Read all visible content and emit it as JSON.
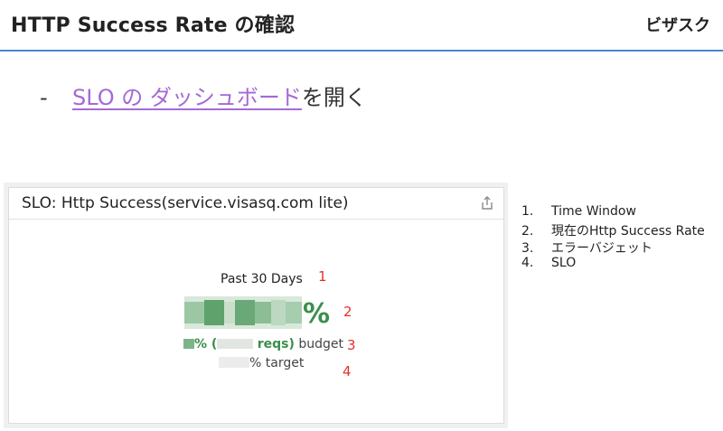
{
  "header": {
    "title": "HTTP Success Rate の確認",
    "brand": "ビザスク"
  },
  "bullet": {
    "dash": "-",
    "link_text": "SLO の ダッシュボード",
    "suffix": "を開く"
  },
  "widget": {
    "title": "SLO: Http Success(service.visasq.com lite)",
    "share_icon": "share-icon",
    "time_window": "Past 30 Days",
    "value_suffix": "%",
    "budget_pct_suffix": "% (",
    "budget_reqs": "reqs)",
    "budget_word": "budget",
    "target_text": "% target"
  },
  "markers": [
    "1",
    "2",
    "3",
    "4"
  ],
  "legend": [
    {
      "num": "1.",
      "label": "Time Window"
    },
    {
      "num": "2.",
      "label": "現在のHttp Success Rate"
    },
    {
      "num": "3.",
      "label": "エラーバジェット"
    },
    {
      "num": "4.",
      "label": "SLO"
    }
  ],
  "colors": {
    "accent_rule": "#4a86c8",
    "link": "#a569d6",
    "success_green": "#3a8f4c",
    "marker_red": "#e0322b"
  }
}
